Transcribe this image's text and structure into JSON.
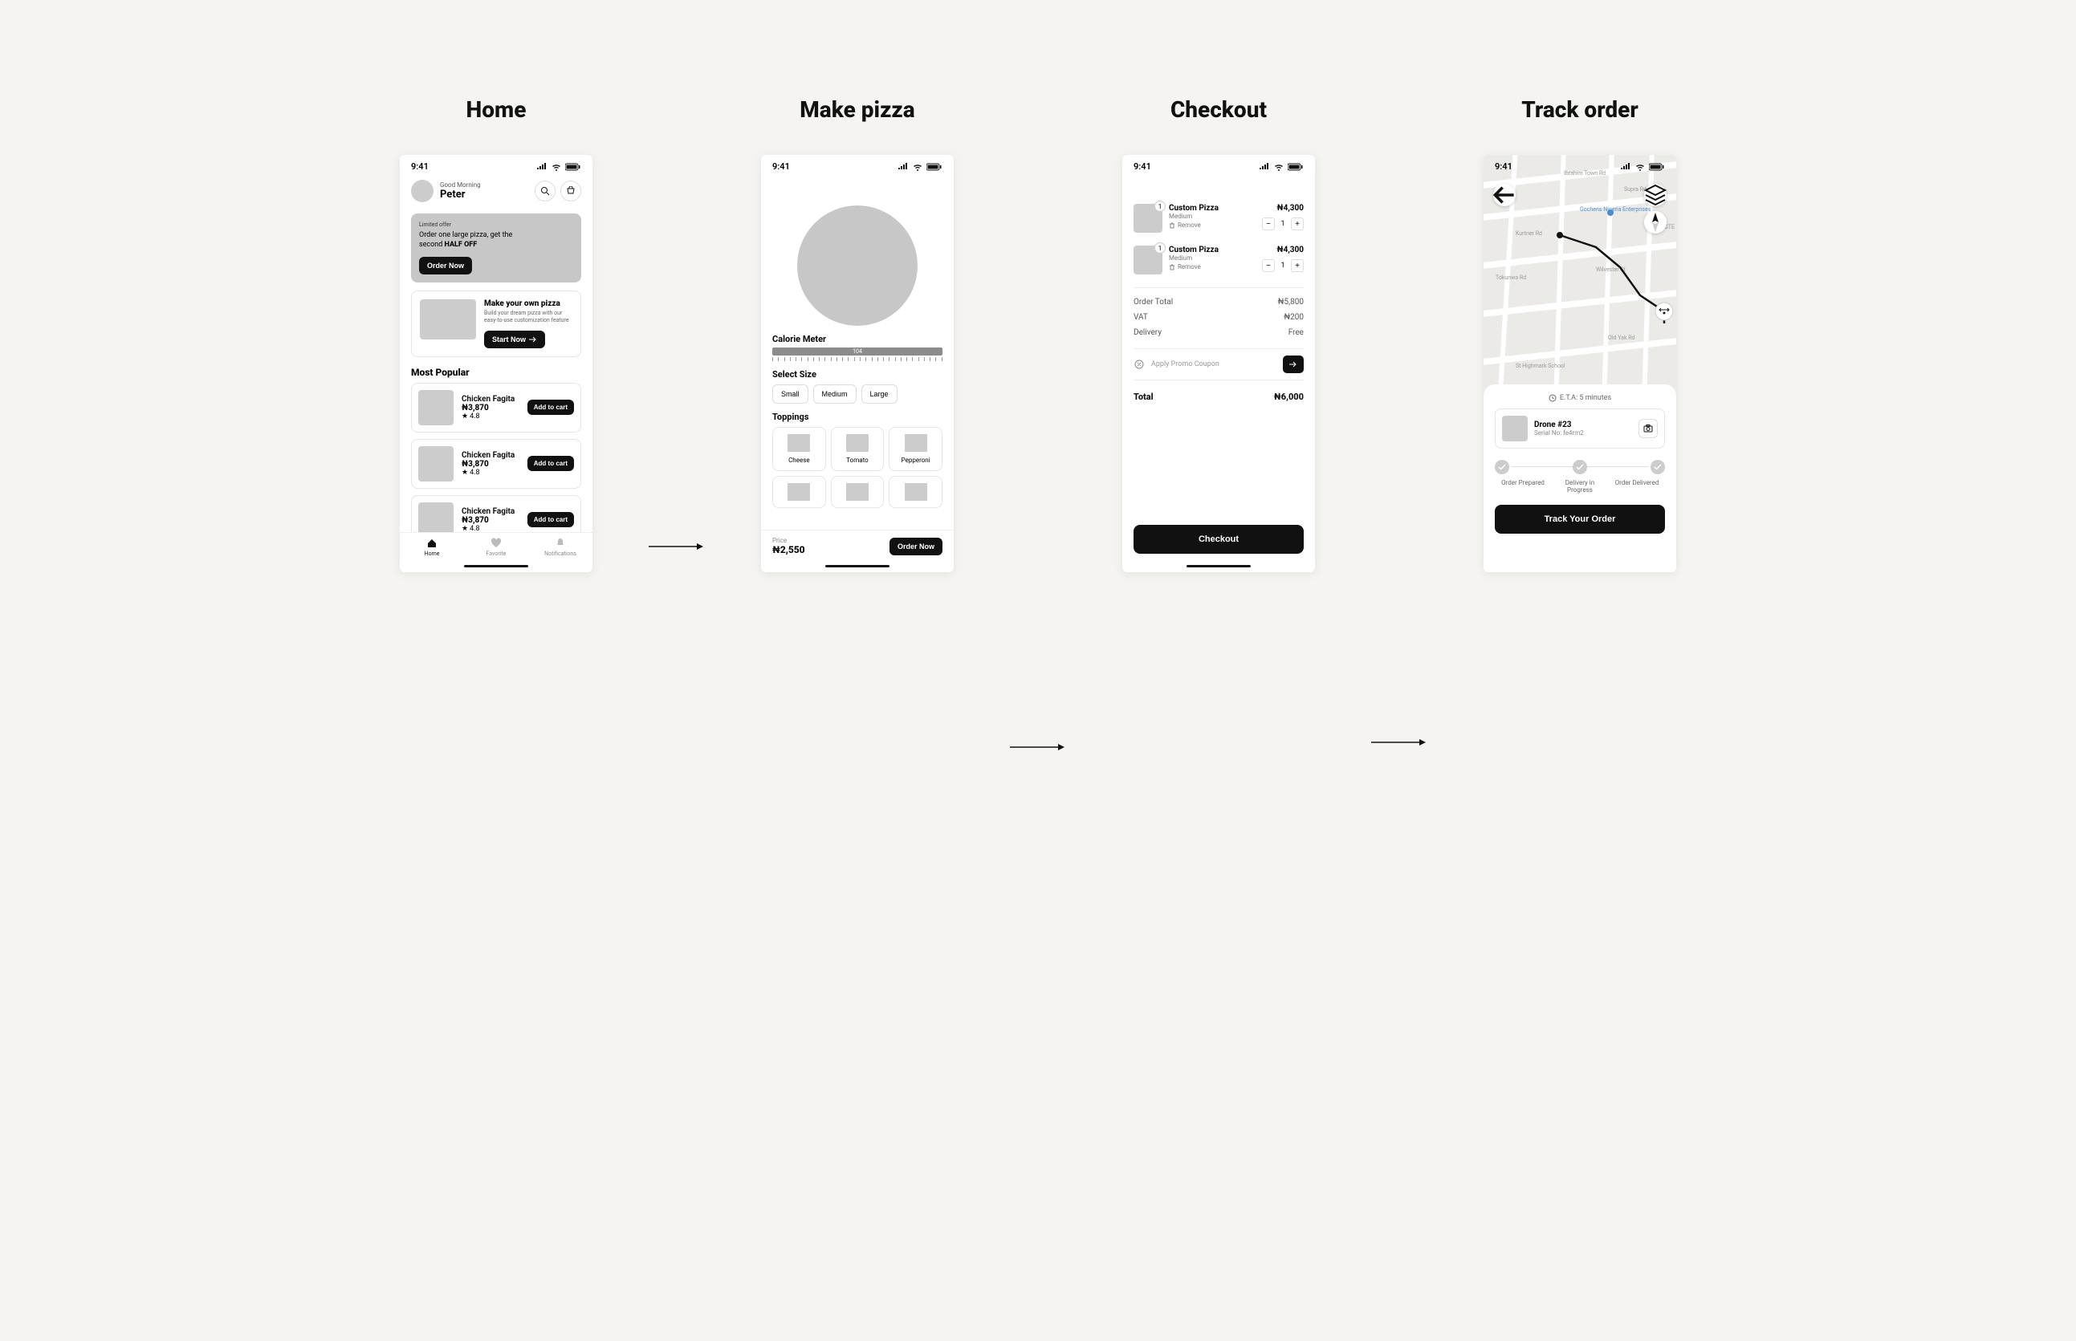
{
  "titles": {
    "home": "Home",
    "make_pizza": "Make pizza",
    "checkout": "Checkout",
    "track_order": "Track order"
  },
  "status": {
    "time": "9:41"
  },
  "home": {
    "greeting_small": "Good Morning",
    "greeting_name": "Peter",
    "promo": {
      "tag": "Limited offer",
      "line1": "Order one large pizza, get the ",
      "line2": "second",
      "bold": "HALF OFF",
      "cta": "Order Now"
    },
    "make_card": {
      "title": "Make your own pizza",
      "desc": "Build your dream pizza with our easy-to-use customization feature",
      "cta": "Start Now"
    },
    "popular_h": "Most  Popular",
    "items": [
      {
        "name": "Chicken Fagita",
        "price": "₦3,870",
        "rating": "4.8",
        "cta": "Add to cart"
      },
      {
        "name": "Chicken Fagita",
        "price": "₦3,870",
        "rating": "4.8",
        "cta": "Add to cart"
      },
      {
        "name": "Chicken Fagita",
        "price": "₦3,870",
        "rating": "4.8",
        "cta": "Add to cart"
      }
    ],
    "nav": {
      "home": "Home",
      "favorite": "Favorite",
      "notifications": "Notifications"
    }
  },
  "make": {
    "calorie_label": "Calorie Meter",
    "calorie_value": "104",
    "size_label": "Select Size",
    "sizes": [
      "Small",
      "Medium",
      "Large"
    ],
    "toppings_label": "Toppings",
    "toppings": [
      "Cheese",
      "Tomato",
      "Pepperoni"
    ],
    "price_label": "Price",
    "price": "₦2,550",
    "cta": "Order Now"
  },
  "checkout": {
    "items": [
      {
        "name": "Custom Pizza",
        "sub": "Medium",
        "remove": "Remove",
        "badge": "1",
        "price": "₦4,300",
        "qty": "1"
      },
      {
        "name": "Custom Pizza",
        "sub": "Medium",
        "remove": "Remove",
        "badge": "1",
        "price": "₦4,300",
        "qty": "1"
      }
    ],
    "order_total_label": "Order Total",
    "order_total": "₦5,800",
    "vat_label": "VAT",
    "vat": "₦200",
    "delivery_label": "Delivery",
    "delivery": "Free",
    "promo_placeholder": "Apply Promo Coupon",
    "total_label": "Total",
    "total": "₦6,000",
    "cta": "Checkout"
  },
  "track": {
    "eta": "E.T.A: 5 minutes",
    "drone_name": "Drone #23",
    "drone_serial": "Serial No: fe4rm2",
    "steps": [
      "Order Prepared",
      "Delivery in Progress",
      "Order Delivered"
    ],
    "cta": "Track Your Order",
    "map_places": {
      "p1": "Ibrahim Town Rd",
      "p2": "Supra Rd",
      "p3": "Gochens Nigeria Enterprises",
      "p4": "Kurtner Rd",
      "p5": "Tokunwa Rd",
      "p6": "Wilvester St",
      "p7": "Old Yak Rd",
      "p8": "St Highmark School",
      "p9": "GTE"
    }
  }
}
